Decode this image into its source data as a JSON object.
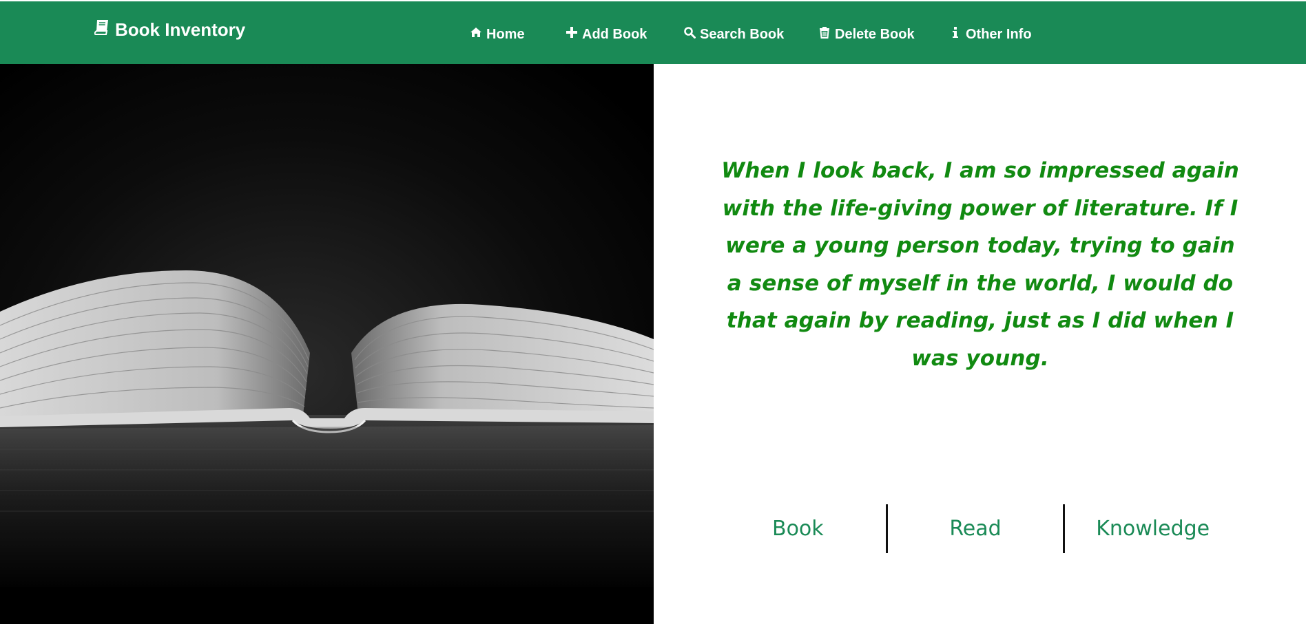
{
  "navbar": {
    "brand": {
      "label": "Book Inventory",
      "icon": "book-icon"
    },
    "items": [
      {
        "label": "Home",
        "icon": "home-icon"
      },
      {
        "label": "Add Book",
        "icon": "plus-icon"
      },
      {
        "label": "Search Book",
        "icon": "search-icon"
      },
      {
        "label": "Delete Book",
        "icon": "trash-icon"
      },
      {
        "label": "Other Info",
        "icon": "info-icon"
      }
    ]
  },
  "quote": {
    "text": "When I look back, I am so impressed again with the life-giving power of literature. If I were a young person today, trying to gain a sense of myself in the world, I would do that again by reading, just as I did when I was young."
  },
  "tags": [
    "Book",
    "Read",
    "Knowledge"
  ],
  "colors": {
    "navbar": "#1a8a56",
    "quote": "#118a11",
    "tag": "#1a8a56"
  }
}
